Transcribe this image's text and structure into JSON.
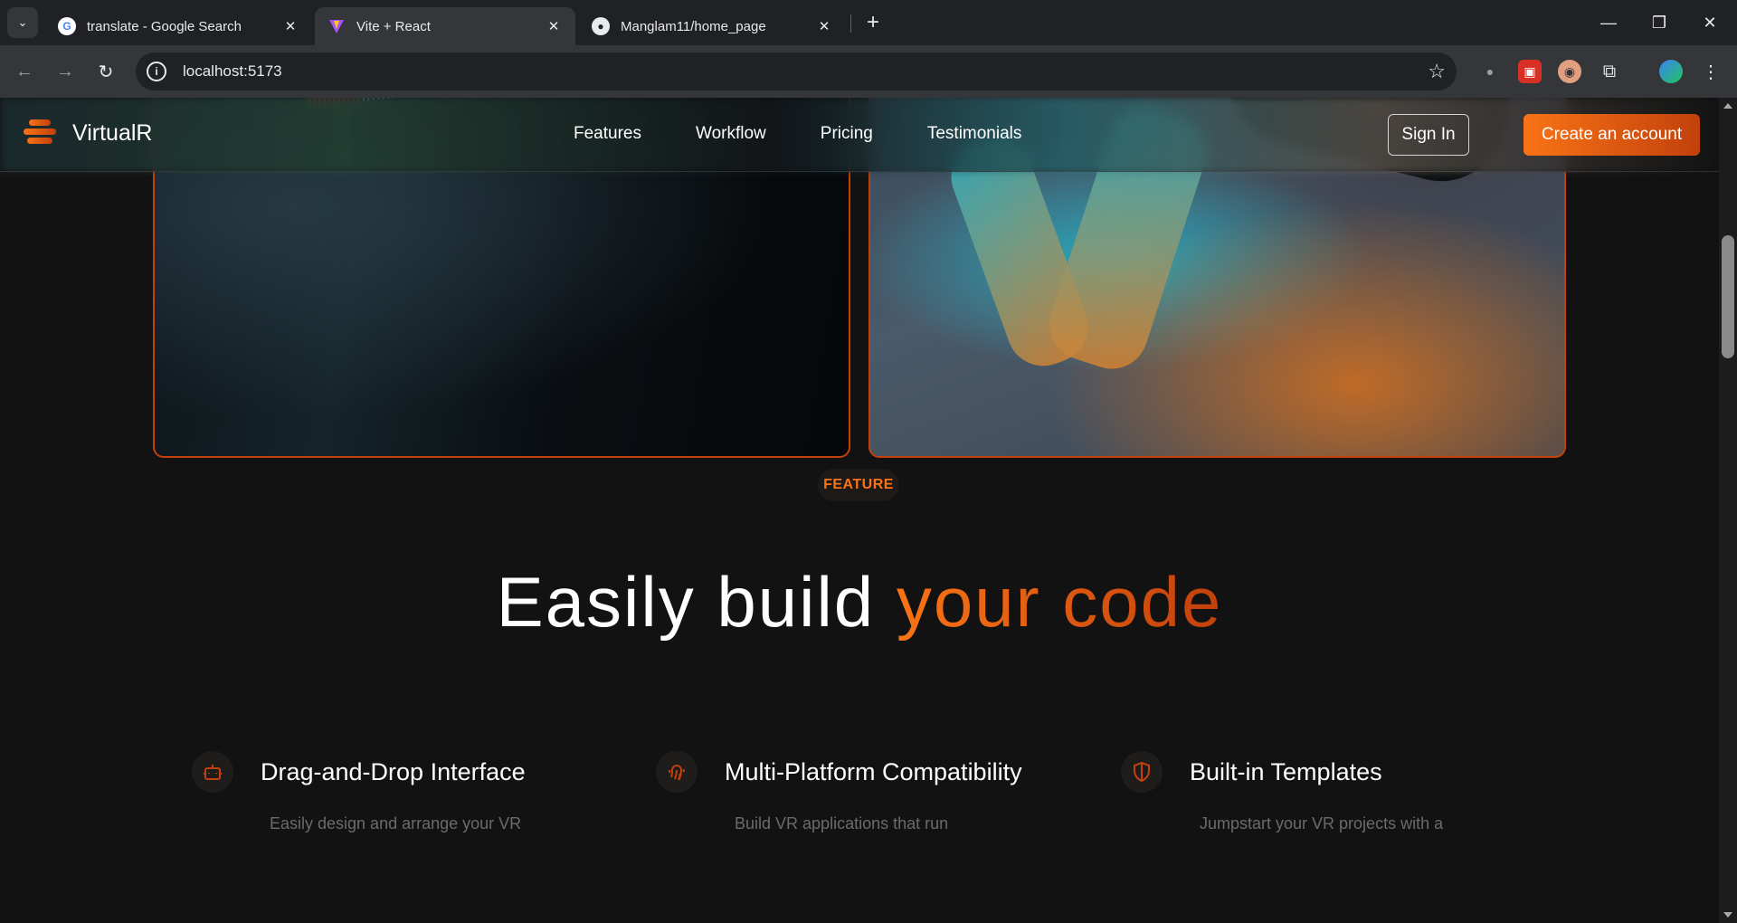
{
  "browser": {
    "tabs": [
      {
        "title": "translate - Google Search",
        "favicon": "google-icon"
      },
      {
        "title": "Vite + React",
        "favicon": "vite-icon"
      },
      {
        "title": "Manglam11/home_page",
        "favicon": "github-icon"
      }
    ],
    "url": "localhost:5173"
  },
  "navbar": {
    "brand": "VirtualR",
    "links": [
      "Features",
      "Workflow",
      "Pricing",
      "Testimonials"
    ],
    "sign_in": "Sign In",
    "create_account": "Create an account"
  },
  "feature_section": {
    "badge": "FEATURE",
    "heading_plain": "Easily build ",
    "heading_accent": "your code",
    "features": [
      {
        "title": "Drag-and-Drop Interface",
        "icon": "bot-icon",
        "desc": "Easily design and arrange your VR"
      },
      {
        "title": "Multi-Platform Compatibility",
        "icon": "fingerprint-icon",
        "desc": "Build VR applications that run"
      },
      {
        "title": "Built-in Templates",
        "icon": "shield-icon",
        "desc": "Jumpstart your VR projects with a"
      }
    ]
  },
  "colors": {
    "accent": "#f97316",
    "accent_dark": "#c2410c",
    "background": "#121212"
  }
}
